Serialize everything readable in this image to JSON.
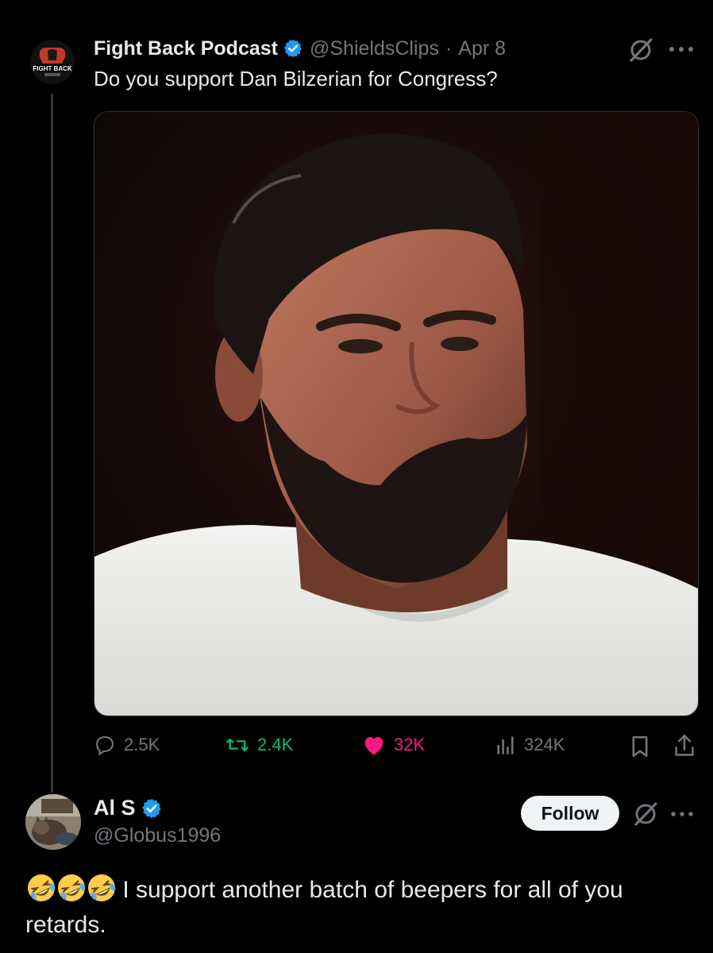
{
  "tweet": {
    "author_name": "Fight Back Podcast",
    "avatar_text": "FIGHT BACK",
    "handle": "@ShieldsClips",
    "separator": "·",
    "date": "Apr 8",
    "text": "Do you support Dan Bilzerian for Congress?",
    "media_icon": "photo-portrait-bearded-man",
    "stats": {
      "replies": "2.5K",
      "retweets": "2.4K",
      "likes": "32K",
      "views": "324K"
    }
  },
  "reply": {
    "author_name": "Al S",
    "handle": "@Globus1996",
    "follow_label": "Follow",
    "emoji_icon": "rolling-on-floor-laughing-emoji",
    "emoji_count": 3,
    "text_line1": "I support another batch of beepers for all of you",
    "text_line2": "retards."
  },
  "colors": {
    "background": "#000000",
    "text": "#e7e9ea",
    "secondary": "#71767b",
    "verified": "#1d9bf0",
    "retweet": "#00ba7c",
    "like": "#f91880",
    "emoji": "#ffcc4d"
  }
}
